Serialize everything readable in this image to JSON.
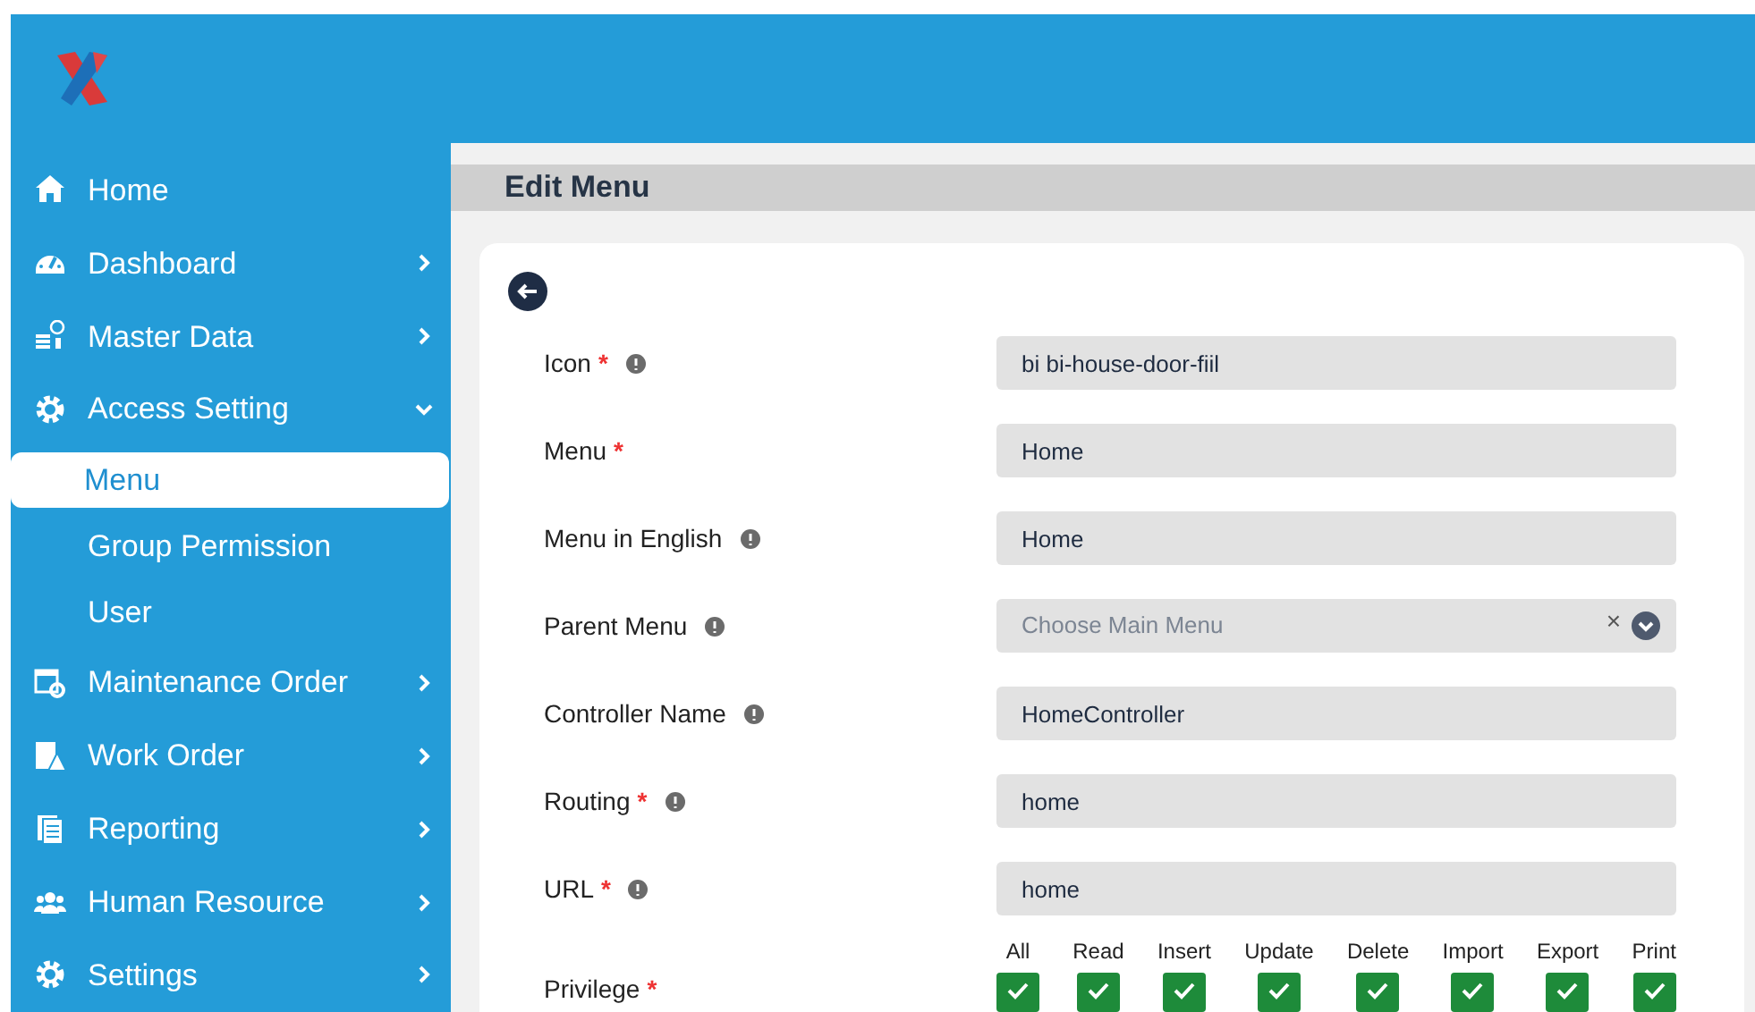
{
  "sidebar": {
    "items": [
      {
        "label": "Home"
      },
      {
        "label": "Dashboard",
        "expanded": false
      },
      {
        "label": "Master Data",
        "expanded": false
      },
      {
        "label": "Access Setting",
        "expanded": true,
        "children": [
          {
            "label": "Menu",
            "selected": true
          },
          {
            "label": "Group Permission",
            "selected": false
          },
          {
            "label": "User",
            "selected": false
          }
        ]
      },
      {
        "label": "Maintenance Order",
        "expanded": false
      },
      {
        "label": "Work Order",
        "expanded": false
      },
      {
        "label": "Reporting",
        "expanded": false
      },
      {
        "label": "Human Resource",
        "expanded": false
      },
      {
        "label": "Settings",
        "expanded": false
      }
    ]
  },
  "page_title": "Edit Menu",
  "form": {
    "fields": [
      {
        "kind": "text",
        "label": "Icon",
        "required_mark": "*",
        "info": true,
        "value": "bi bi-house-door-fiil"
      },
      {
        "kind": "text",
        "label": "Menu",
        "required_mark": "*",
        "info": false,
        "value": "Home"
      },
      {
        "kind": "text",
        "label": "Menu in English",
        "info": true,
        "value": "Home"
      },
      {
        "kind": "select",
        "label": "Parent Menu",
        "info": true,
        "placeholder": "Choose Main Menu",
        "clear": "×"
      },
      {
        "kind": "text",
        "label": "Controller Name",
        "info": true,
        "value": "HomeController"
      },
      {
        "kind": "text",
        "label": "Routing",
        "required_mark": "*",
        "info": true,
        "value": "home"
      },
      {
        "kind": "text",
        "label": "URL",
        "required_mark": "*",
        "info": true,
        "value": "home"
      }
    ],
    "privilege": {
      "label": "Privilege",
      "required_mark": "*",
      "options": [
        {
          "label": "All",
          "checked": true
        },
        {
          "label": "Read",
          "checked": true
        },
        {
          "label": "Insert",
          "checked": true
        },
        {
          "label": "Update",
          "checked": true
        },
        {
          "label": "Delete",
          "checked": true
        },
        {
          "label": "Import",
          "checked": true
        },
        {
          "label": "Export",
          "checked": true
        },
        {
          "label": "Print",
          "checked": true
        }
      ]
    }
  }
}
